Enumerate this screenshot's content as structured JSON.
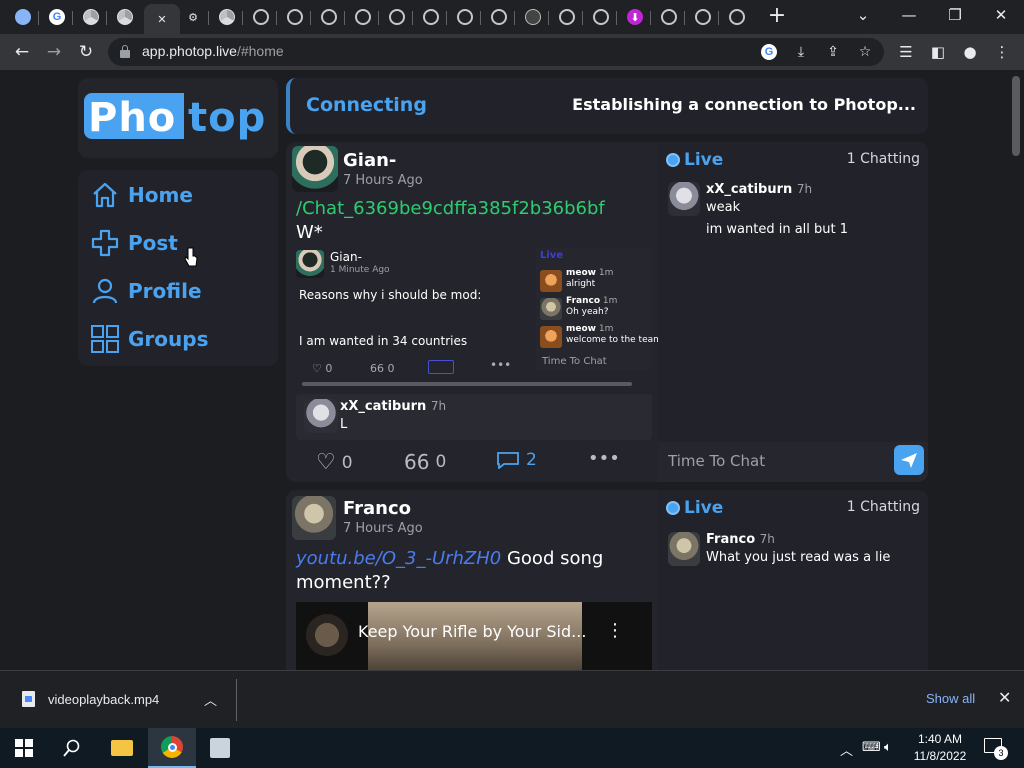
{
  "browser": {
    "url_host": "app.photop.live",
    "url_path": "/#home",
    "tabs": [
      {
        "icon": "cloud-icon"
      },
      {
        "icon": "google-icon"
      },
      {
        "icon": "chrome-icon"
      },
      {
        "icon": "chrome-icon"
      },
      {
        "icon": "close-icon",
        "active": true
      },
      {
        "icon": "gear-icon"
      },
      {
        "icon": "chrome-icon"
      },
      {
        "icon": "globe-icon"
      },
      {
        "icon": "globe-icon"
      },
      {
        "icon": "globe-icon"
      },
      {
        "icon": "globe-icon"
      },
      {
        "icon": "globe-icon"
      },
      {
        "icon": "globe-icon"
      },
      {
        "icon": "globe-icon"
      },
      {
        "icon": "globe-icon"
      },
      {
        "icon": "clapperboard-icon"
      },
      {
        "icon": "globe-icon"
      },
      {
        "icon": "globe-icon"
      },
      {
        "icon": "download-app-icon"
      },
      {
        "icon": "globe-icon"
      },
      {
        "icon": "globe-icon"
      },
      {
        "icon": "globe-icon"
      }
    ]
  },
  "app": {
    "logo_part1": "Pho",
    "logo_part2": "top",
    "accent": "#4aa3f0",
    "nav": [
      {
        "label": "Home",
        "icon": "home-icon"
      },
      {
        "label": "Post",
        "icon": "plus-icon"
      },
      {
        "label": "Profile",
        "icon": "user-icon"
      },
      {
        "label": "Groups",
        "icon": "groups-icon"
      }
    ],
    "status": {
      "title": "Connecting",
      "message": "Establishing a connection to Photop..."
    }
  },
  "posts": [
    {
      "author": "Gian-",
      "time": "7 Hours Ago",
      "link": "/Chat_6369be9cdffa385f2b36b6bf",
      "text": "W*",
      "embed": {
        "author": "Gian-",
        "time": "1 Minute Ago",
        "line1": "Reasons why i should be mod:",
        "line2": "I am wanted in 34 countries",
        "likes": "0",
        "quotes": "0",
        "live_label": "Live",
        "chat_placeholder": "Time To Chat",
        "chat": [
          {
            "name": "meow",
            "time": "1m",
            "text": "alright"
          },
          {
            "name": "Franco",
            "time": "1m",
            "text": "Oh yeah?"
          },
          {
            "name": "meow",
            "time": "1m",
            "text": "welcome to the team"
          }
        ]
      },
      "reply": {
        "name": "xX_catiburn",
        "time": "7h",
        "text": "L"
      },
      "likes": "0",
      "quotes": "0",
      "comments": "2",
      "chat": {
        "live": "Live",
        "chatting": "1 Chatting",
        "placeholder": "Time To Chat",
        "messages": [
          {
            "name": "xX_catiburn",
            "time": "7h",
            "lines": [
              "weak",
              "im wanted in all but 1"
            ]
          }
        ]
      }
    },
    {
      "author": "Franco",
      "time": "7 Hours Ago",
      "link": "youtu.be/O_3_-UrhZH0",
      "text_after_link": " Good song",
      "text_line2": "moment??",
      "video_title": "Keep Your Rifle by Your Sid...",
      "chat": {
        "live": "Live",
        "chatting": "1 Chatting",
        "messages": [
          {
            "name": "Franco",
            "time": "7h",
            "text": "What you just read was a lie"
          }
        ]
      }
    }
  ],
  "download_bar": {
    "filename": "videoplayback.mp4",
    "show_all": "Show all"
  },
  "taskbar": {
    "time": "1:40 AM",
    "date": "11/8/2022",
    "notification_count": "3"
  }
}
